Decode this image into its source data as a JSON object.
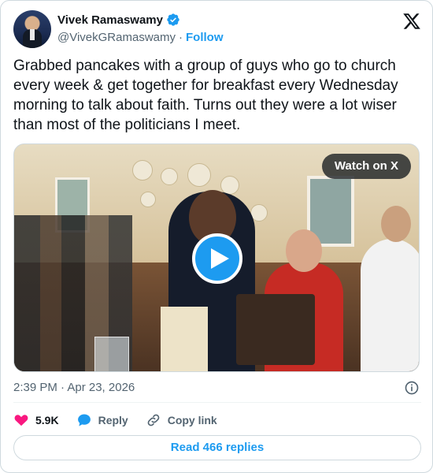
{
  "author": {
    "name": "Vivek Ramaswamy",
    "handle": "@VivekGRamaswamy",
    "separator": "·",
    "follow_label": "Follow"
  },
  "tweet": {
    "text": "Grabbed pancakes with a group of guys who go to church every week & get together for breakfast every Wednesday morning to talk about faith. Turns out they were a lot wiser than most of the politicians I meet."
  },
  "media": {
    "watch_label": "Watch on X"
  },
  "timestamp": "2:39 PM · Apr 23, 2026",
  "actions": {
    "likes": "5.9K",
    "reply_label": "Reply",
    "copy_link_label": "Copy link"
  },
  "replies_button": "Read 466 replies",
  "colors": {
    "accent": "#1d9bf0",
    "like": "#f91880",
    "text_secondary": "#536471"
  },
  "icons": [
    "verified-badge-icon",
    "x-logo-icon",
    "play-icon",
    "info-icon",
    "heart-icon",
    "reply-bubble-icon",
    "link-icon"
  ]
}
